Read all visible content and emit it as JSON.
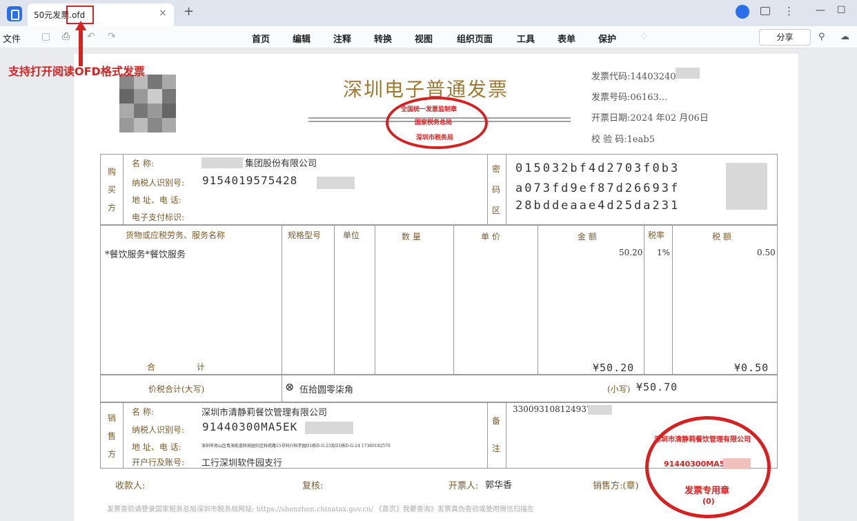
{
  "tab": {
    "title": "50元发票.ofd",
    "close": "×",
    "new_tab": "+"
  },
  "window": {
    "minimize": "—",
    "maximize": "☐"
  },
  "toolbar": {
    "file": "文件",
    "menu": [
      "首页",
      "编辑",
      "注释",
      "转换",
      "视图",
      "组织页面",
      "工具",
      "表单",
      "保护"
    ],
    "share": "分享"
  },
  "annotation": {
    "text": "支持打开阅读OFD格式发票"
  },
  "invoice": {
    "title": "深圳电子普通发票",
    "stamp_top": "全国统一发票监制章",
    "stamp_mid": "国家税务总局",
    "stamp_bottom": "深圳市税务局",
    "code_label": "发票代码:",
    "code": "14403240",
    "number_label": "发票号码:",
    "number": "06163...",
    "date_label": "开票日期:",
    "date": "2024 年02 月06日",
    "check_label": "校 验 码:",
    "check": "1eab5",
    "buyer": {
      "side": "购买方",
      "name_label": "名 称:",
      "name": "集团股份有限公司",
      "tax_label": "纳税人识别号:",
      "tax": "9154019575428",
      "addr_label": "地 址、电 话:",
      "pay_label": "电子支付标识:"
    },
    "cipher": {
      "side": "密码区",
      "lines": [
        "015032bf4d2703f0b3",
        "a073fd9ef87d26693f",
        "28bddeaae4d25da231"
      ]
    },
    "columns": [
      "货物或应税劳务、服务名称",
      "规格型号",
      "单位",
      "数 量",
      "单 价",
      "金 额",
      "税率",
      "税 额"
    ],
    "item": {
      "name": "*餐饮服务*餐饮服务",
      "amount": "50.20",
      "rate": "1%",
      "tax": "0.50"
    },
    "total_label": "合 计",
    "total_amount": "¥50.20",
    "total_tax": "¥0.50",
    "grand_label": "价税合计(大写)",
    "grand_upper": "伍拾圆零柒角",
    "grand_lower_label": "(小写)",
    "grand_lower": "¥50.70",
    "seller": {
      "side": "销售方",
      "name_label": "名 称:",
      "name": "深圳市清静莉餐饮管理有限公司",
      "tax_label": "纳税人识别号:",
      "tax": "91440300MA5EK",
      "addr_label": "地 址、电 话:",
      "addr": "深圳市南山区粤海街道科技园社区科苑路15号科兴科学园D1栋D-G-23及D1栋D-G-24 17360182570",
      "bank_label": "开户行及账号:",
      "bank": "工行深圳软件园支行"
    },
    "remark_side": "备注",
    "remark": "330093108124937",
    "seal_company": "深圳市清静莉餐饮管理有限公司",
    "seal_id": "91440300MA5E",
    "seal_title": "发票专用章",
    "seal_num": "(0)",
    "footer": {
      "payee": "收款人:",
      "reviewer": "复核:",
      "drawer": "开票人:",
      "drawer_name": "郭华香",
      "seller_seal": "销售方:(章)"
    },
    "footnote": "发票查验请登录国家税务总局深圳市税务局网站: https://shenzhen.chinatax.gov.cn/ 《首页》我要查询》发票真伪查验或使用微信扫描左"
  }
}
